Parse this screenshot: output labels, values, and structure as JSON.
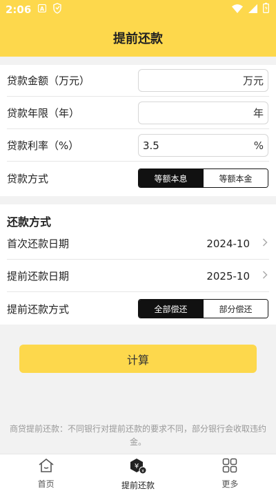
{
  "status_bar": {
    "time": "2:06",
    "icons": [
      "notification-a-icon",
      "notification-app-icon",
      "wifi-icon",
      "signal-icon",
      "battery-icon"
    ]
  },
  "header": {
    "title": "提前还款",
    "background": "#fdd84c"
  },
  "loan_form": {
    "amount": {
      "label": "贷款金额（万元）",
      "value": "",
      "unit": "万元"
    },
    "years": {
      "label": "贷款年限（年）",
      "value": "",
      "unit": "年"
    },
    "rate": {
      "label": "贷款利率（%）",
      "value": "3.5",
      "unit": "%"
    },
    "method": {
      "label": "贷款方式",
      "options": [
        "等额本息",
        "等额本金"
      ],
      "selected": "等额本息"
    }
  },
  "repay_section": {
    "title": "还款方式",
    "first_date": {
      "label": "首次还款日期",
      "value": "2024-10"
    },
    "prepay_date": {
      "label": "提前还款日期",
      "value": "2025-10"
    },
    "prepay_method": {
      "label": "提前还款方式",
      "options": [
        "全部偿还",
        "部分偿还"
      ],
      "selected": "全部偿还"
    }
  },
  "calculate_button": "计算",
  "note": "商贷提前还款：不同银行对提前还款的要求不同，部分银行会收取违约金。",
  "tabbar": {
    "items": [
      {
        "label": "首页",
        "icon": "home-icon"
      },
      {
        "label": "提前还款",
        "icon": "yuan-hexagon-icon"
      },
      {
        "label": "更多",
        "icon": "grid-icon"
      }
    ],
    "active": "提前还款"
  }
}
